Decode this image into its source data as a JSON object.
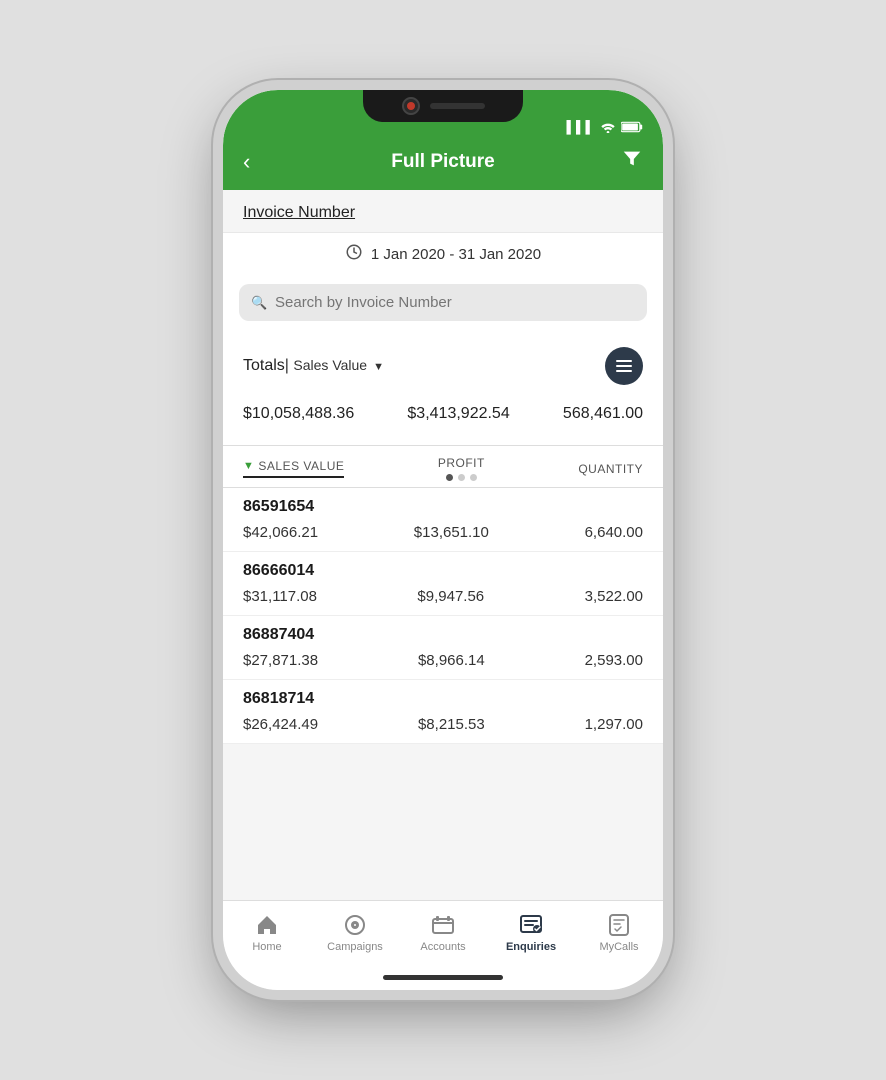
{
  "phone": {
    "status": {
      "signal": "▌▌▌",
      "wifi": "wifi",
      "battery": "battery"
    }
  },
  "header": {
    "back_label": "<",
    "title": "Full Picture",
    "filter_icon": "filter"
  },
  "invoice_section": {
    "label": "Invoice Number"
  },
  "date_range": {
    "text": "1 Jan 2020 - 31 Jan 2020"
  },
  "search": {
    "placeholder": "Search by Invoice Number"
  },
  "totals": {
    "label": "Totals",
    "sort_by": "Sales Value",
    "value1": "$10,058,488.36",
    "value2": "$3,413,922.54",
    "value3": "568,461.00"
  },
  "table": {
    "columns": [
      {
        "id": "sales_value",
        "label": "SALES VALUE",
        "active": true
      },
      {
        "id": "profit",
        "label": "PROFIT",
        "active": false
      },
      {
        "id": "quantity",
        "label": "QUANTITY",
        "active": false
      }
    ],
    "rows": [
      {
        "id": "86591654",
        "sales_value": "$42,066.21",
        "profit": "$13,651.10",
        "quantity": "6,640.00"
      },
      {
        "id": "86666014",
        "sales_value": "$31,117.08",
        "profit": "$9,947.56",
        "quantity": "3,522.00"
      },
      {
        "id": "86887404",
        "sales_value": "$27,871.38",
        "profit": "$8,966.14",
        "quantity": "2,593.00"
      },
      {
        "id": "86818714",
        "sales_value": "$26,424.49",
        "profit": "$8,215.53",
        "quantity": "1,297.00"
      }
    ]
  },
  "tab_bar": {
    "items": [
      {
        "id": "home",
        "label": "Home",
        "active": false
      },
      {
        "id": "campaigns",
        "label": "Campaigns",
        "active": false
      },
      {
        "id": "accounts",
        "label": "Accounts",
        "active": false
      },
      {
        "id": "enquiries",
        "label": "Enquiries",
        "active": true
      },
      {
        "id": "mycalls",
        "label": "MyCalls",
        "active": false
      }
    ]
  }
}
